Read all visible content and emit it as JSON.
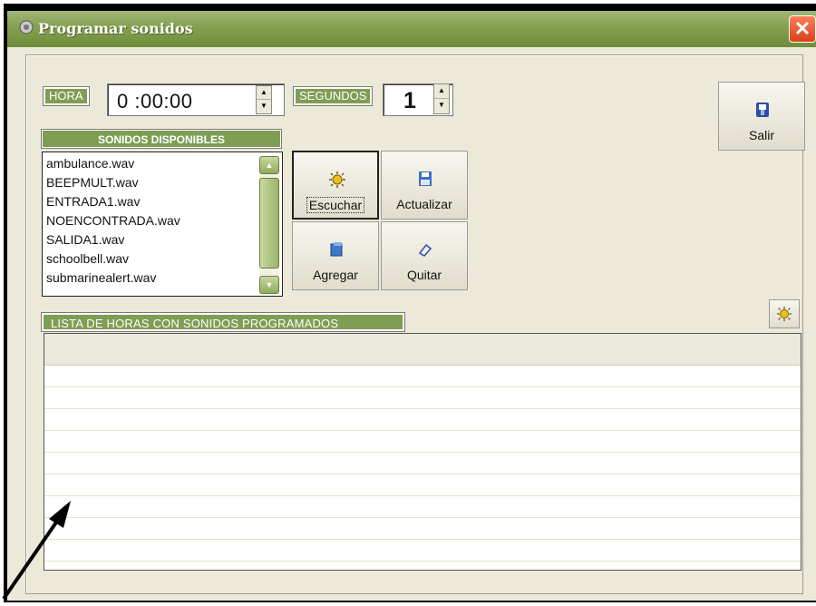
{
  "window": {
    "title": "Programar sonidos",
    "close_glyph": "✕"
  },
  "hora": {
    "label": "HORA",
    "value": "0 :00:00"
  },
  "segundos": {
    "label": "SEGUNDOS",
    "value": "1"
  },
  "salir": {
    "label": "Salir",
    "icon": "exit-icon"
  },
  "sounds": {
    "header": "SONIDOS DISPONIBLES",
    "items": [
      "ambulance.wav",
      "BEEPMULT.wav",
      "ENTRADA1.wav",
      "NOENCONTRADA.wav",
      "SALIDA1.wav",
      "schoolbell.wav",
      "submarinealert.wav"
    ]
  },
  "actions": {
    "escuchar": "Escuchar",
    "actualizar": "Actualizar",
    "agregar": "Agregar",
    "quitar": "Quitar"
  },
  "scheduled": {
    "header": "LISTA DE HORAS CON SONIDOS PROGRAMADOS",
    "rows": []
  },
  "colors": {
    "title_bar": "#87a253",
    "label_bg": "#7f9d53",
    "window_bg": "#ece9d8"
  }
}
